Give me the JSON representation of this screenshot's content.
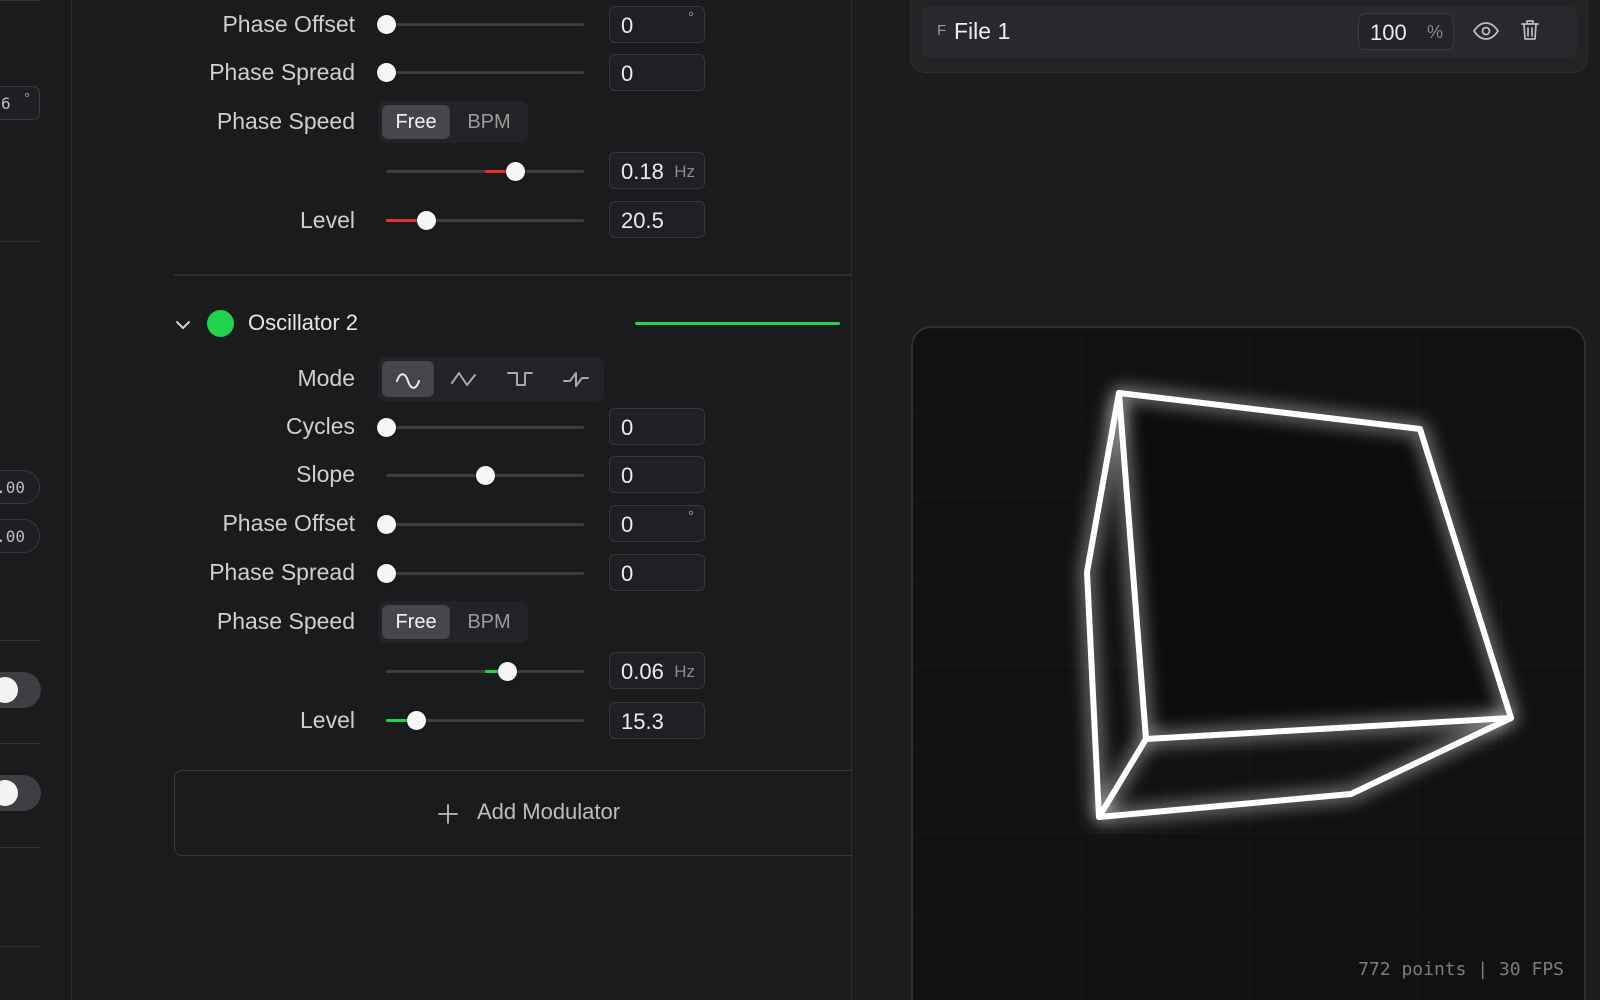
{
  "left_strip": {
    "angle_value": "6",
    "angle_unit": "°",
    "field_1": ".00",
    "field_2": ".00"
  },
  "oscillator_1": {
    "color": "#e5312b",
    "phase_offset": {
      "label": "Phase Offset",
      "value": "0",
      "unit": "°",
      "slider": 0.0
    },
    "phase_spread": {
      "label": "Phase Spread",
      "value": "0",
      "slider": 0.0
    },
    "phase_speed": {
      "label": "Phase Speed",
      "options": [
        "Free",
        "BPM"
      ],
      "selected": "Free",
      "value": "0.18",
      "unit": "Hz",
      "slider": 0.65
    },
    "level": {
      "label": "Level",
      "value": "20.5",
      "slider": 0.2
    }
  },
  "oscillator_2": {
    "name": "Oscillator 2",
    "color": "#22d24d",
    "mode": {
      "label": "Mode",
      "options": [
        "sine",
        "triangle",
        "square",
        "sawtooth"
      ],
      "selected": "sine"
    },
    "cycles": {
      "label": "Cycles",
      "value": "0",
      "slider": 0.0
    },
    "slope": {
      "label": "Slope",
      "value": "0",
      "slider": 0.5
    },
    "phase_offset": {
      "label": "Phase Offset",
      "value": "0",
      "unit": "°",
      "slider": 0.0
    },
    "phase_spread": {
      "label": "Phase Spread",
      "value": "0",
      "slider": 0.0
    },
    "phase_speed": {
      "label": "Phase Speed",
      "options": [
        "Free",
        "BPM"
      ],
      "selected": "Free",
      "value": "0.06",
      "unit": "Hz",
      "slider": 0.61
    },
    "level": {
      "label": "Level",
      "value": "15.3",
      "slider": 0.15
    }
  },
  "add_modulator": {
    "label": "Add Modulator"
  },
  "layer": {
    "badge": "F",
    "name": "File 1",
    "opacity": "100",
    "opacity_unit": "%"
  },
  "preview": {
    "readout": "772 points | 30 FPS"
  }
}
